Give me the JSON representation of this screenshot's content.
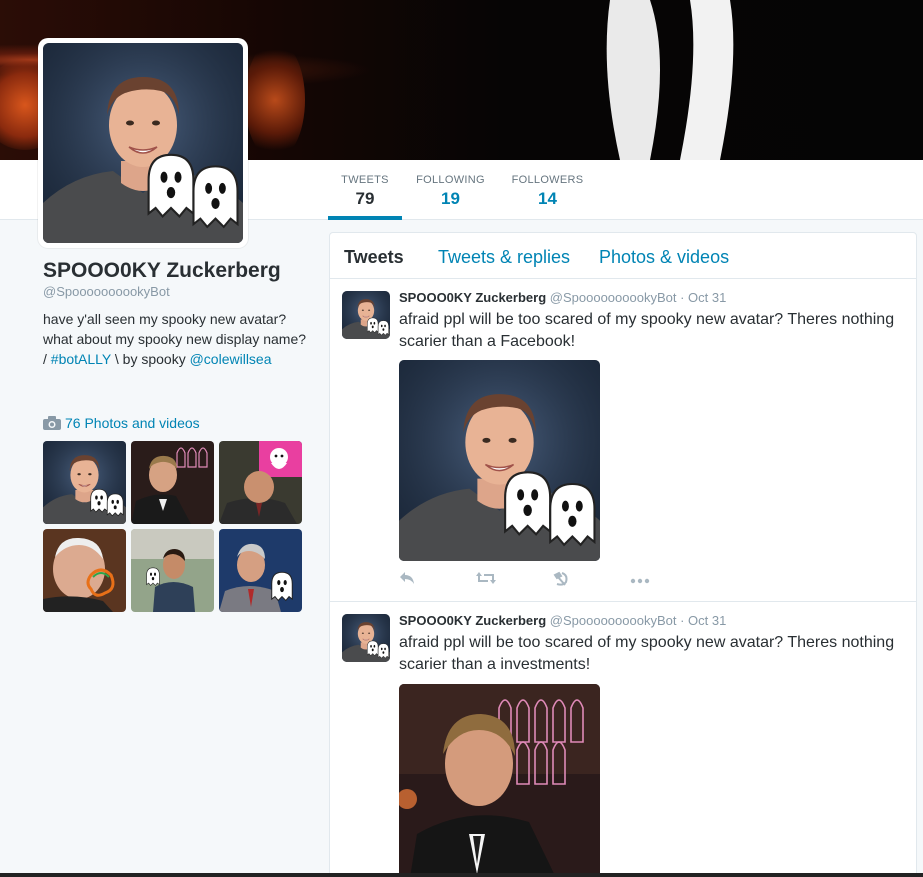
{
  "profile": {
    "name": "SPOOO0KY Zuckerberg",
    "handle": "@SpoooooooookyBot",
    "bio_part1": "have y'all seen my spooky new avatar? what about my spooky new display name? / ",
    "bio_hashtag": "#botALLY",
    "bio_part2": " \\ by spooky ",
    "bio_mention": "@colewillsea"
  },
  "stats": [
    {
      "label": "TWEETS",
      "value": "79"
    },
    {
      "label": "FOLLOWING",
      "value": "19"
    },
    {
      "label": "FOLLOWERS",
      "value": "14"
    }
  ],
  "photos": {
    "link_label": "76 Photos and videos"
  },
  "timeline": {
    "tabs": [
      {
        "label": "Tweets"
      },
      {
        "label": "Tweets & replies"
      },
      {
        "label": "Photos & videos"
      }
    ],
    "tweets": [
      {
        "name": "SPOOO0KY Zuckerberg",
        "handle": "@SpoooooooookyBot",
        "time": "· Oct 31",
        "text": "afraid ppl will be too scared of my spooky new avatar? Theres nothing scarier than a Facebook!"
      },
      {
        "name": "SPOOO0KY Zuckerberg",
        "handle": "@SpoooooooookyBot",
        "time": "· Oct 31",
        "text": "afraid ppl will be too scared of my spooky new avatar? Theres nothing scarier than a investments!"
      }
    ]
  },
  "icons": [
    "camera-icon",
    "reply-icon",
    "retweet-icon",
    "hammer-sickle-icon",
    "more-icon",
    "ghost-icon"
  ],
  "colors": {
    "accent": "#0084b4",
    "text": "#292f33",
    "muted": "#8899a6",
    "background": "#f5f8fa"
  }
}
